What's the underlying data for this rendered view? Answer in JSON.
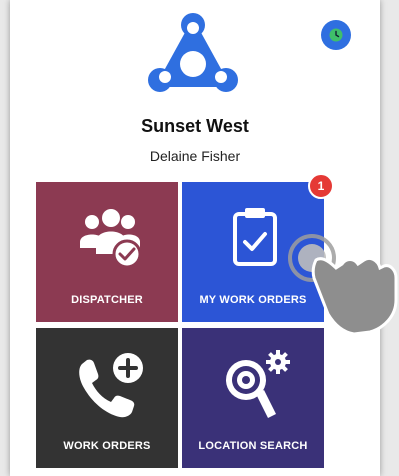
{
  "header": {
    "title": "Sunset West",
    "user_name": "Delaine Fisher"
  },
  "status_indicator": {
    "icon": "clock-icon"
  },
  "tiles": [
    {
      "label": "DISPATCHER",
      "icon": "team-check-icon",
      "color": "#8c3a52"
    },
    {
      "label": "MY WORK ORDERS",
      "icon": "clipboard-check-icon",
      "color": "#2c55d6",
      "badge": "1"
    },
    {
      "label": "WORK ORDERS",
      "icon": "phone-add-icon",
      "color": "#333333"
    },
    {
      "label": "LOCATION SEARCH",
      "icon": "gear-search-icon",
      "color": "#3a3178"
    }
  ],
  "colors": {
    "brand": "#2f6fe0",
    "badge": "#e53935"
  }
}
